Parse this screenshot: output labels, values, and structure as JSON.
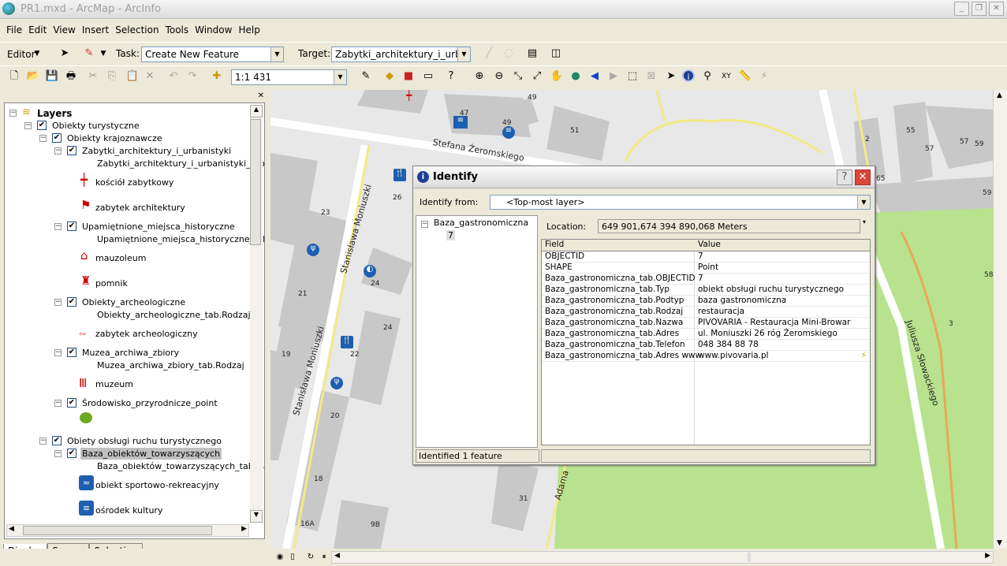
{
  "window": {
    "title": "PR1.mxd - ArcMap - ArcInfo"
  },
  "menu": [
    "File",
    "Edit",
    "View",
    "Insert",
    "Selection",
    "Tools",
    "Window",
    "Help"
  ],
  "editor_toolbar": {
    "editor_label": "Editor",
    "task_label": "Task:",
    "task_value": "Create New Feature",
    "target_label": "Target:",
    "target_value": "Zabytki_architektury_i_urbanisty"
  },
  "standard_toolbar": {
    "scale_value": "1:1 431"
  },
  "toc": {
    "root": "Layers",
    "items": [
      {
        "label": "Obiekty turystyczne"
      },
      {
        "label": "Obiekty krajoznawcze"
      },
      {
        "label": "Zabytki_architektury_i_urbanistyki"
      },
      {
        "label": "Zabytki_architektury_i_urbanistyki_tab."
      },
      {
        "label": "kościół zabytkowy"
      },
      {
        "label": "zabytek architektury"
      },
      {
        "label": "Upamiętnione_miejsca_historyczne"
      },
      {
        "label": "Upamiętnione_miejsca_historyczne_tab."
      },
      {
        "label": "mauzoleum"
      },
      {
        "label": "pomnik"
      },
      {
        "label": "Obiekty_archeologiczne"
      },
      {
        "label": "Obiekty_archeologiczne_tab.Rodzaj"
      },
      {
        "label": "zabytek archeologiczny"
      },
      {
        "label": "Muzea_archiwa_zbiory"
      },
      {
        "label": "Muzea_archiwa_zbiory_tab.Rodzaj"
      },
      {
        "label": "muzeum"
      },
      {
        "label": "Środowisko_przyrodnicze_point"
      },
      {
        "label": "Obiety obsługi ruchu turystycznego"
      },
      {
        "label": "Baza_obiektów_towarzyszących"
      },
      {
        "label": "Baza_obiektów_towarzyszących_tab.Ga"
      },
      {
        "label": "obiekt sportowo-rekreacyjny"
      },
      {
        "label": "ośrodek kultury"
      }
    ],
    "tabs": [
      "Display",
      "Source",
      "Selection"
    ]
  },
  "map": {
    "streets": [
      "Stefana Żeromskiego",
      "Stanisława Moniuszki",
      "Stanisława Moniuszki",
      "Juliusza Słowackiego",
      "Adama"
    ],
    "numbers": [
      "47",
      "49",
      "49",
      "51",
      "2",
      "55",
      "57",
      "57",
      "59",
      "65",
      "59",
      "23",
      "26",
      "21",
      "24",
      "24",
      "19",
      "22",
      "20",
      "18",
      "16A",
      "9B",
      "31",
      "3",
      "58"
    ],
    "colors": {
      "park": "#b8e28e",
      "building": "#c8c8c8",
      "road": "#ffffff",
      "major_road": "#f3ea84"
    }
  },
  "identify": {
    "title": "Identify",
    "from_label": "Identify from:",
    "from_value": "<Top-most layer>",
    "tree_layer": "Baza_gastronomiczna",
    "tree_feature": "7",
    "location_label": "Location:",
    "location_value": "649 901,674  394 890,068 Meters",
    "col_field": "Field",
    "col_value": "Value",
    "rows": [
      {
        "field": "OBJECTID",
        "value": "7"
      },
      {
        "field": "SHAPE",
        "value": "Point"
      },
      {
        "field": "Baza_gastronomiczna_tab.OBJECTID",
        "value": "7"
      },
      {
        "field": "Baza_gastronomiczna_tab.Typ",
        "value": "obiekt obsługi ruchu turystycznego"
      },
      {
        "field": "Baza_gastronomiczna_tab.Podtyp",
        "value": "baza gastronomiczna"
      },
      {
        "field": "Baza_gastronomiczna_tab.Rodzaj",
        "value": "restauracja"
      },
      {
        "field": "Baza_gastronomiczna_tab.Nazwa",
        "value": "PIVOVARIA - Restauracja Mini-Browar"
      },
      {
        "field": "Baza_gastronomiczna_tab.Adres",
        "value": "ul. Moniuszki 26 róg Żeromskiego"
      },
      {
        "field": "Baza_gastronomiczna_tab.Telefon",
        "value": "048 384 88 78"
      },
      {
        "field": "Baza_gastronomiczna_tab.Adres www",
        "value": "www.pivovaria.pl"
      }
    ],
    "status": "Identified 1 feature"
  }
}
